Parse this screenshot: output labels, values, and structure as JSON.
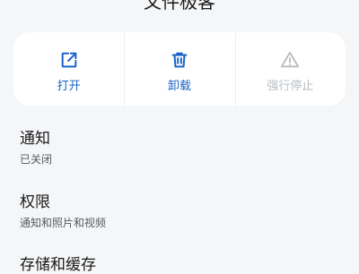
{
  "header": {
    "title": "文件极客"
  },
  "actions": [
    {
      "label": "打开",
      "icon": "open-external-icon",
      "state": "enabled"
    },
    {
      "label": "卸载",
      "icon": "trash-icon",
      "state": "enabled"
    },
    {
      "label": "强行停止",
      "icon": "warning-triangle-icon",
      "state": "disabled"
    }
  ],
  "settings": [
    {
      "title": "通知",
      "subtitle": "已关闭"
    },
    {
      "title": "权限",
      "subtitle": "通知和照片和视频"
    },
    {
      "title": "存储和缓存"
    }
  ],
  "colors": {
    "accent": "#1a63c8",
    "disabled": "#b8bcc2",
    "background": "#f5f6f8",
    "card": "#ffffff"
  }
}
